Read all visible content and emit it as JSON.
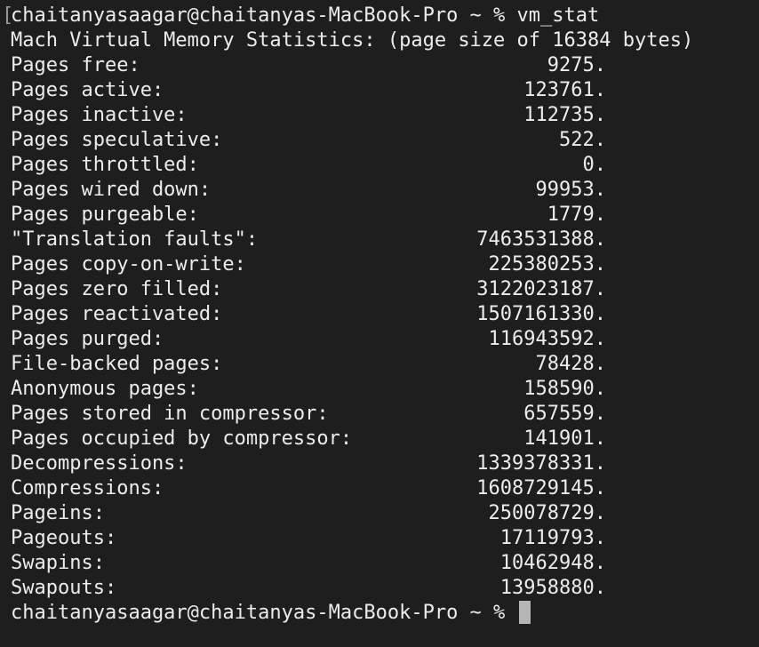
{
  "terminal": {
    "command_prompt": "chaitanyasaagar@chaitanyas-MacBook-Pro ~ % vm_stat",
    "header": "Mach Virtual Memory Statistics: (page size of 16384 bytes)",
    "final_prompt": "chaitanyasaagar@chaitanyas-MacBook-Pro ~ % ",
    "rows": [
      {
        "label": "Pages free:",
        "value": "9275."
      },
      {
        "label": "Pages active:",
        "value": "123761."
      },
      {
        "label": "Pages inactive:",
        "value": "112735."
      },
      {
        "label": "Pages speculative:",
        "value": "522."
      },
      {
        "label": "Pages throttled:",
        "value": "0."
      },
      {
        "label": "Pages wired down:",
        "value": "99953."
      },
      {
        "label": "Pages purgeable:",
        "value": "1779."
      },
      {
        "label": "\"Translation faults\":",
        "value": "7463531388."
      },
      {
        "label": "Pages copy-on-write:",
        "value": "225380253."
      },
      {
        "label": "Pages zero filled:",
        "value": "3122023187."
      },
      {
        "label": "Pages reactivated:",
        "value": "1507161330."
      },
      {
        "label": "Pages purged:",
        "value": "116943592."
      },
      {
        "label": "File-backed pages:",
        "value": "78428."
      },
      {
        "label": "Anonymous pages:",
        "value": "158590."
      },
      {
        "label": "Pages stored in compressor:",
        "value": "657559."
      },
      {
        "label": "Pages occupied by compressor:",
        "value": "141901."
      },
      {
        "label": "Decompressions:",
        "value": "1339378331."
      },
      {
        "label": "Compressions:",
        "value": "1608729145."
      },
      {
        "label": "Pageins:",
        "value": "250078729."
      },
      {
        "label": "Pageouts:",
        "value": "17119793."
      },
      {
        "label": "Swapins:",
        "value": "10462948."
      },
      {
        "label": "Swapouts:",
        "value": "13958880."
      }
    ]
  }
}
